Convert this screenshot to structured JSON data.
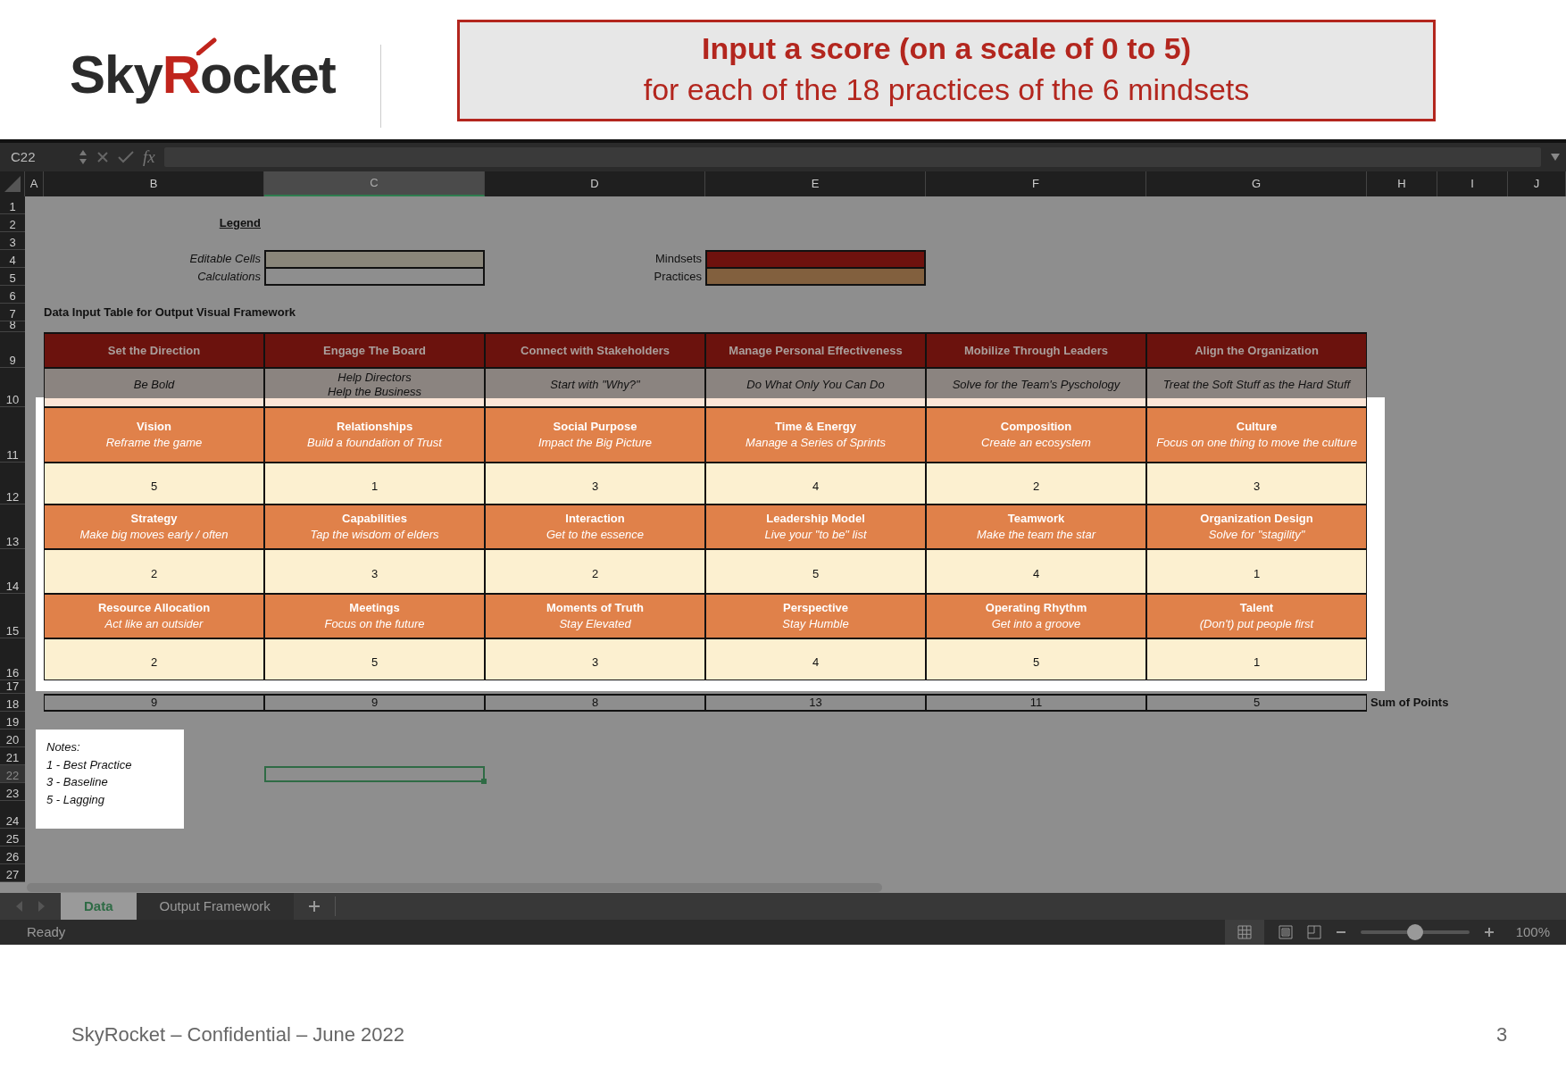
{
  "logo": {
    "parts": [
      {
        "text": "Sky",
        "color": "#2b2b2b"
      },
      {
        "text": "R",
        "color": "#c0241c"
      },
      {
        "text": "ocket",
        "color": "#2b2b2b"
      }
    ]
  },
  "banner": {
    "title": "Input a score (on a scale of 0 to 5)",
    "subtitle": "for each of the 18 practices of the 6 mindsets"
  },
  "spreadsheet": {
    "name_box": "C22",
    "function_label": "fx",
    "columns": [
      {
        "label": "A",
        "selected": false
      },
      {
        "label": "B",
        "selected": false
      },
      {
        "label": "C",
        "selected": true
      },
      {
        "label": "D",
        "selected": false
      },
      {
        "label": "E",
        "selected": false
      },
      {
        "label": "F",
        "selected": false
      },
      {
        "label": "G",
        "selected": false
      },
      {
        "label": "H",
        "selected": false
      },
      {
        "label": "I",
        "selected": false
      },
      {
        "label": "J",
        "selected": false
      }
    ],
    "rows": [
      {
        "label": "1",
        "selected": false
      },
      {
        "label": "2",
        "selected": false
      },
      {
        "label": "3",
        "selected": false
      },
      {
        "label": "4",
        "selected": false
      },
      {
        "label": "5",
        "selected": false
      },
      {
        "label": "6",
        "selected": false
      },
      {
        "label": "7",
        "selected": false
      },
      {
        "label": "8",
        "selected": false
      },
      {
        "label": "9",
        "selected": false
      },
      {
        "label": "10",
        "selected": false
      },
      {
        "label": "11",
        "selected": false
      },
      {
        "label": "12",
        "selected": false
      },
      {
        "label": "13",
        "selected": false
      },
      {
        "label": "14",
        "selected": false
      },
      {
        "label": "15",
        "selected": false
      },
      {
        "label": "16",
        "selected": false
      },
      {
        "label": "17",
        "selected": false
      },
      {
        "label": "18",
        "selected": false
      },
      {
        "label": "19",
        "selected": false
      },
      {
        "label": "20",
        "selected": false
      },
      {
        "label": "21",
        "selected": false
      },
      {
        "label": "22",
        "selected": true
      },
      {
        "label": "23",
        "selected": false
      },
      {
        "label": "24",
        "selected": false
      },
      {
        "label": "25",
        "selected": false
      },
      {
        "label": "26",
        "selected": false
      },
      {
        "label": "27",
        "selected": false
      }
    ],
    "legend": {
      "title": "Legend",
      "items": [
        {
          "label": "Editable Cells",
          "color": "#8a867a"
        },
        {
          "label": "Calculations",
          "color": "#8e8e8e"
        },
        {
          "label": "Mindsets",
          "color": "#6e120e"
        },
        {
          "label": "Practices",
          "color": "#82603e"
        }
      ]
    },
    "table_title": "Data Input Table for Output Visual Framework",
    "mindsets": [
      {
        "name": "Set the Direction",
        "motto": [
          "Be Bold"
        ],
        "practices": [
          {
            "name": "Vision",
            "motto": "Reframe the game",
            "score": "5"
          },
          {
            "name": "Strategy",
            "motto": "Make big moves early / often",
            "score": "2"
          },
          {
            "name": "Resource Allocation",
            "motto": "Act like an outsider",
            "score": "2"
          }
        ]
      },
      {
        "name": "Engage The Board",
        "motto": [
          "Help Directors",
          "Help the Business"
        ],
        "practices": [
          {
            "name": "Relationships",
            "motto": "Build a foundation of Trust",
            "score": "1"
          },
          {
            "name": "Capabilities",
            "motto": "Tap the wisdom of elders",
            "score": "3"
          },
          {
            "name": "Meetings",
            "motto": "Focus on the future",
            "score": "5"
          }
        ]
      },
      {
        "name": "Connect with Stakeholders",
        "motto": [
          "Start with \"Why?\""
        ],
        "practices": [
          {
            "name": "Social Purpose",
            "motto": "Impact the Big Picture",
            "score": "3"
          },
          {
            "name": "Interaction",
            "motto": "Get to the essence",
            "score": "2"
          },
          {
            "name": "Moments of Truth",
            "motto": "Stay Elevated",
            "score": "3"
          }
        ]
      },
      {
        "name": "Manage Personal Effectiveness",
        "motto": [
          "Do What Only You Can Do"
        ],
        "practices": [
          {
            "name": "Time & Energy",
            "motto": "Manage a Series of Sprints",
            "score": "4"
          },
          {
            "name": "Leadership Model",
            "motto": "Live your \"to be\" list",
            "score": "5"
          },
          {
            "name": "Perspective",
            "motto": "Stay Humble",
            "score": "4"
          }
        ]
      },
      {
        "name": "Mobilize Through Leaders",
        "motto": [
          "Solve for the Team's Pyschology"
        ],
        "practices": [
          {
            "name": "Composition",
            "motto": "Create an ecosystem",
            "score": "2"
          },
          {
            "name": "Teamwork",
            "motto": "Make the team the star",
            "score": "4"
          },
          {
            "name": "Operating Rhythm",
            "motto": "Get into a groove",
            "score": "5"
          }
        ]
      },
      {
        "name": "Align the Organization",
        "motto": [
          "Treat the Soft Stuff as the Hard Stuff"
        ],
        "practices": [
          {
            "name": "Culture",
            "motto": "Focus on one thing to move the culture",
            "score": "3"
          },
          {
            "name": "Organization Design",
            "motto": "Solve for \"stagility\"",
            "score": "1"
          },
          {
            "name": "Talent",
            "motto": "(Don't) put people first",
            "score": "1"
          }
        ]
      }
    ],
    "sums": [
      "9",
      "9",
      "8",
      "13",
      "11",
      "5"
    ],
    "sum_label": "Sum of Points",
    "notes": {
      "title": "Notes:",
      "lines": [
        "1 - Best Practice",
        "3 - Baseline",
        "5 - Lagging"
      ]
    },
    "sheet_tabs": [
      {
        "label": "Data",
        "selected": true
      },
      {
        "label": "Output Framework",
        "selected": false
      }
    ],
    "status": "Ready",
    "zoom": {
      "level": 0.5,
      "reading": "100%"
    }
  },
  "footer": {
    "text": "SkyRocket – Confidential – June 2022",
    "page": "3"
  }
}
